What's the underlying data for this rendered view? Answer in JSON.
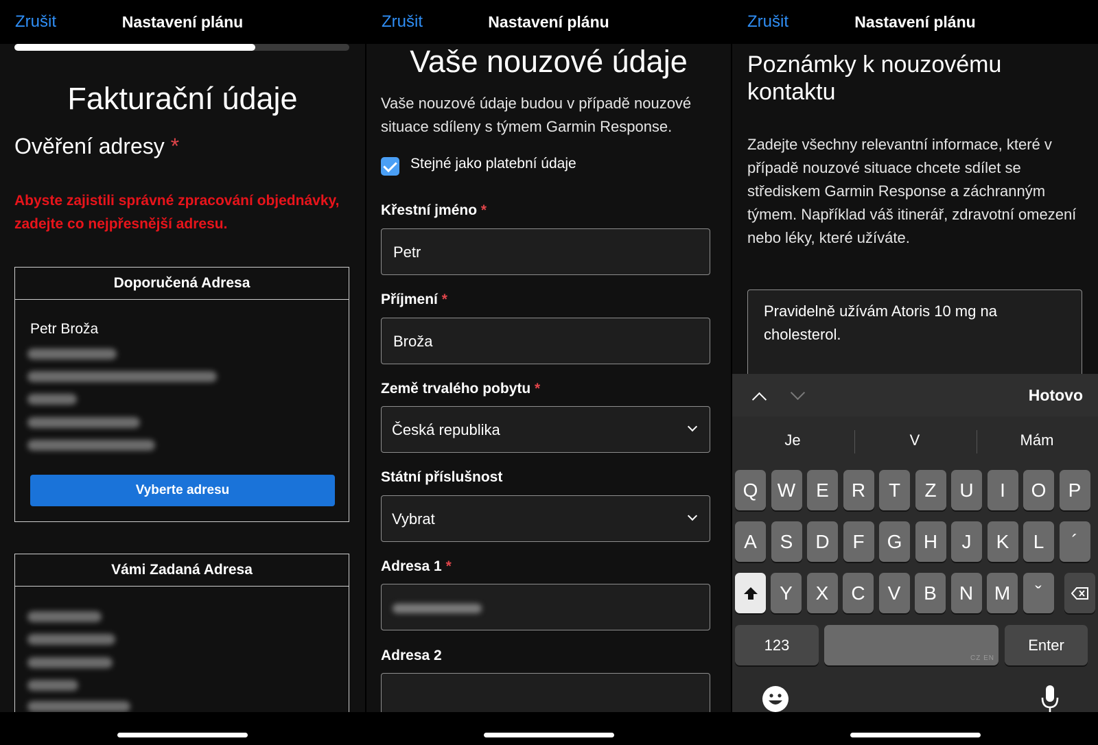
{
  "panels": [
    {
      "cancel": "Zrušit",
      "title": "Nastavení plánu",
      "progress": 0.72,
      "heading": "Fakturační údaje",
      "subheading": "Ověření adresy",
      "required_mark": "*",
      "warning": "Abyste zajistili správné zpracování objednávky, zadejte co nejpřesnější adresu.",
      "recommended": {
        "header": "Doporučená Adresa",
        "name": "Petr Broža",
        "button": "Vyberte adresu"
      },
      "entered": {
        "header": "Vámi Zadaná Adresa"
      }
    },
    {
      "cancel": "Zrušit",
      "title": "Nastavení plánu",
      "heading": "Vaše nouzové údaje",
      "intro": "Vaše nouzové údaje budou v případě nouzové situace sdíleny s týmem Garmin Response.",
      "checkbox_label": "Stejné jako platební údaje",
      "checkbox_checked": true,
      "required_mark": "*",
      "fields": {
        "first_name": {
          "label": "Křestní jméno",
          "value": "Petr"
        },
        "last_name": {
          "label": "Příjmení",
          "value": "Broža"
        },
        "country": {
          "label": "Země trvalého pobytu",
          "value": "Česká republika"
        },
        "nationality": {
          "label": "Státní příslušnost",
          "value": "Vybrat"
        },
        "address1": {
          "label": "Adresa 1"
        },
        "address2": {
          "label": "Adresa 2",
          "value": ""
        }
      }
    },
    {
      "cancel": "Zrušit",
      "title": "Nastavení plánu",
      "heading": "Poznámky k nouzovému kontaktu",
      "description": "Zadejte všechny relevantní informace, které v případě nouzové situace chcete sdílet se střediskem Garmin Response a záchranným týmem. Například váš itinerář, zdravotní omezení nebo léky, které užíváte.",
      "notes_value": "Pravidelně užívám Atoris 10 mg na cholesterol.",
      "keyboard": {
        "done": "Hotovo",
        "suggestions": [
          "Je",
          "V",
          "Mám"
        ],
        "row1": [
          "Q",
          "W",
          "E",
          "R",
          "T",
          "Z",
          "U",
          "I",
          "O",
          "P"
        ],
        "row2": [
          "A",
          "S",
          "D",
          "F",
          "G",
          "H",
          "J",
          "K",
          "L",
          "´"
        ],
        "row3": [
          "Y",
          "X",
          "C",
          "V",
          "B",
          "N",
          "M",
          "ˇ"
        ],
        "numbers": "123",
        "enter": "Enter",
        "space_hint": "CZ EN"
      }
    }
  ],
  "colors": {
    "accent": "#2f8ef5",
    "warning": "#e8141b",
    "primary_button": "#1a73d9",
    "checkbox": "#4a9ff5"
  }
}
